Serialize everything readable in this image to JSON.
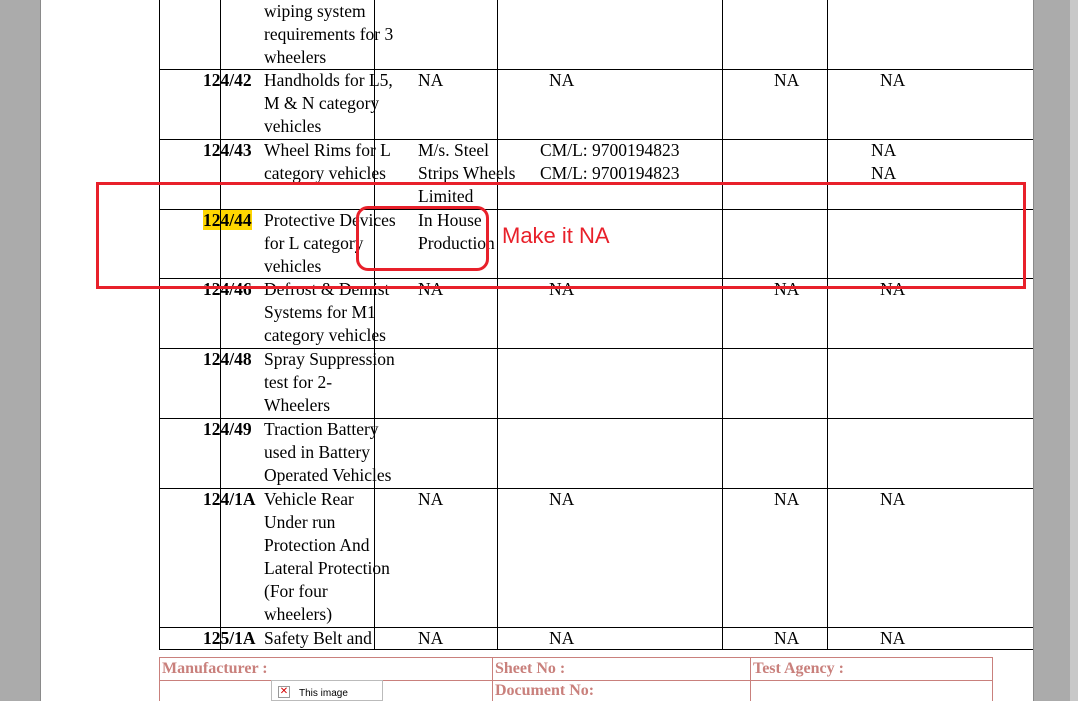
{
  "table": {
    "rows": [
      {
        "code": "",
        "desc": "wiping system\nrequirements for 3\nwheelers",
        "c3": "",
        "c4": "",
        "c5": "",
        "c6": ""
      },
      {
        "code": "124/42",
        "desc": "Handholds for L5,\nM & N category\nvehicles",
        "c3": "NA",
        "c4": "NA",
        "c5": "NA",
        "c6": "NA"
      },
      {
        "code": "124/43",
        "desc": "Wheel Rims for L\ncategory vehicles",
        "c3": "M/s. Steel\nStrips Wheels\nLimited",
        "c4": "CM/L: 9700194823\nCM/L: 9700194823",
        "c5": "",
        "c6": "NA\nNA"
      },
      {
        "code": "124/44",
        "desc": "Protective Devices\nfor L category\nvehicles",
        "c3": "In House\nProduction",
        "c4": "",
        "c5": "",
        "c6": ""
      },
      {
        "code": "124/46",
        "desc": "Defrost & Demist\nSystems for M1\ncategory vehicles",
        "c3": "NA",
        "c4": "NA",
        "c5": "NA",
        "c6": "NA"
      },
      {
        "code": "124/48",
        "desc": "Spray Suppression\ntest for 2-\nWheelers",
        "c3": "",
        "c4": "",
        "c5": "",
        "c6": ""
      },
      {
        "code": "124/49",
        "desc": "Traction Battery\nused in Battery\nOperated Vehicles",
        "c3": "",
        "c4": "",
        "c5": "",
        "c6": ""
      },
      {
        "code": "124/1A",
        "desc": "Vehicle Rear\nUnder run\nProtection And\nLateral Protection\n(For four\nwheelers)",
        "c3": "NA",
        "c4": "NA",
        "c5": "NA",
        "c6": "NA"
      },
      {
        "code": "125/1A",
        "desc": "Safety Belt and",
        "c3": "NA",
        "c4": "NA",
        "c5": "NA",
        "c6": "NA"
      }
    ]
  },
  "annotation": {
    "text": "Make it NA"
  },
  "footer": {
    "manufacturer": "Manufacturer :",
    "sheet_no": "Sheet No :",
    "test_agency": "Test Agency :",
    "document_no": "Document No:",
    "image_placeholder": "This image"
  },
  "colors": {
    "annotation": "#e8202a",
    "highlight": "#ffd700",
    "footer_text": "#c9807c"
  }
}
